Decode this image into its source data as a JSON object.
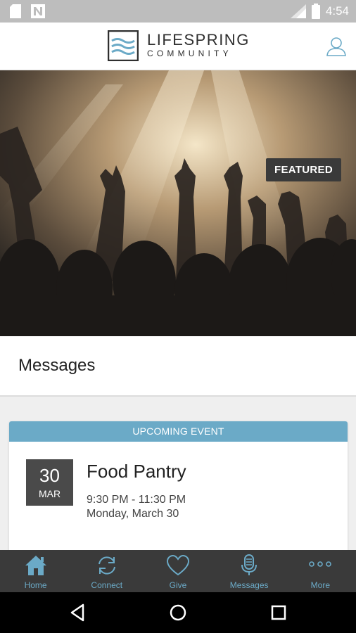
{
  "status_bar": {
    "time": "4:54"
  },
  "header": {
    "brand_line1": "LIFESPRING",
    "brand_line2": "COMMUNITY"
  },
  "hero": {
    "badge": "FEATURED"
  },
  "messages": {
    "title": "Messages"
  },
  "event_card": {
    "header": "UPCOMING EVENT",
    "day": "30",
    "month": "MAR",
    "title": "Food Pantry",
    "time": "9:30 PM - 11:30 PM",
    "date": "Monday, March 30"
  },
  "tabs": [
    {
      "label": "Home",
      "icon": "home-icon"
    },
    {
      "label": "Connect",
      "icon": "sync-icon"
    },
    {
      "label": "Give",
      "icon": "heart-icon"
    },
    {
      "label": "Messages",
      "icon": "microphone-icon"
    },
    {
      "label": "More",
      "icon": "more-dots-icon"
    }
  ],
  "colors": {
    "accent": "#6baac7",
    "tabbar": "#3a3a3a",
    "date_box": "#4a4a4a"
  }
}
